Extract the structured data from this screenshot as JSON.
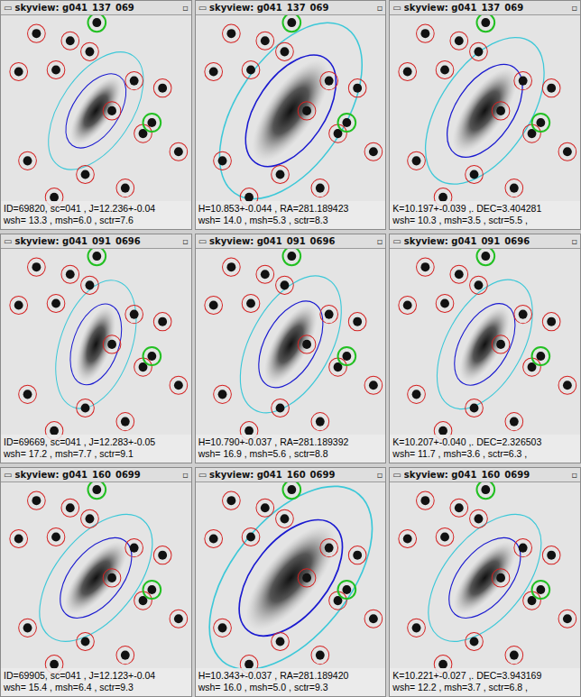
{
  "title_buttons": [
    "▭",
    "▫"
  ],
  "windows": [
    {
      "title": "skyview: g041_137_069",
      "caption": [
        "ID=69820, sc=041 , J=12.236+-0.04",
        "wsh= 13.3 , msh=6.0 , sctr=7.6"
      ]
    },
    {
      "title": "skyview: g041_137_069",
      "caption": [
        "H=10.853+-0.044 , RA=281.189423",
        "wsh= 14.0 , msh=5.3 , sctr=8.3"
      ]
    },
    {
      "title": "skyview: g041_137_069",
      "caption": [
        "K=10.197+-0.039 ,. DEC=3.404281",
        "wsh= 10.3 , msh=3.5 , sctr=5.5 ,"
      ]
    },
    {
      "title": "skyview: g041_091_0696",
      "caption": [
        "ID=69669, sc=041 , J=12.283+-0.05",
        "wsh= 17.2 , msh=7.7 , sctr=9.1"
      ]
    },
    {
      "title": "skyview: g041_091_0696",
      "caption": [
        "H=10.790+-0.037 , RA=281.189392",
        "wsh= 16.9 , msh=5.6 , sctr=8.8"
      ]
    },
    {
      "title": "skyview: g041_091_0696",
      "caption": [
        "K=10.207+-0.040 ,. DEC=2.326503",
        "wsh= 11.7 , msh=3.6 , sctr=6.3 ,"
      ]
    },
    {
      "title": "skyview: g041_160_0699",
      "caption": [
        "ID=69905, sc=041 , J=12.123+-0.04",
        "wsh= 15.4 , msh=6.4 , sctr=9.3"
      ]
    },
    {
      "title": "skyview: g041_160_0699",
      "caption": [
        "H=10.343+-0.037 , RA=281.189420",
        "wsh= 16.0 , msh=5.0 , sctr=9.3"
      ]
    },
    {
      "title": "skyview: g041_160_0699",
      "caption": [
        "K=10.221+-0.027 ,. DEC=3.943169",
        "wsh= 12.2 , msh=3.7 , sctr=6.8 ,"
      ]
    }
  ]
}
